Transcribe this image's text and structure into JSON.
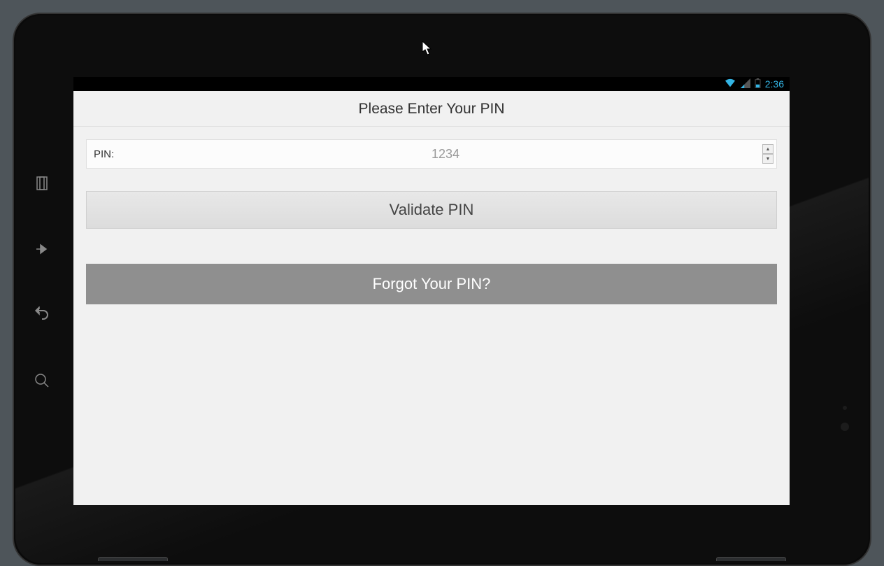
{
  "statusBar": {
    "time": "2:36"
  },
  "header": {
    "title": "Please Enter Your PIN"
  },
  "pinRow": {
    "label": "PIN:",
    "placeholder": "1234"
  },
  "buttons": {
    "validate": "Validate PIN",
    "forgot": "Forgot Your PIN?"
  }
}
